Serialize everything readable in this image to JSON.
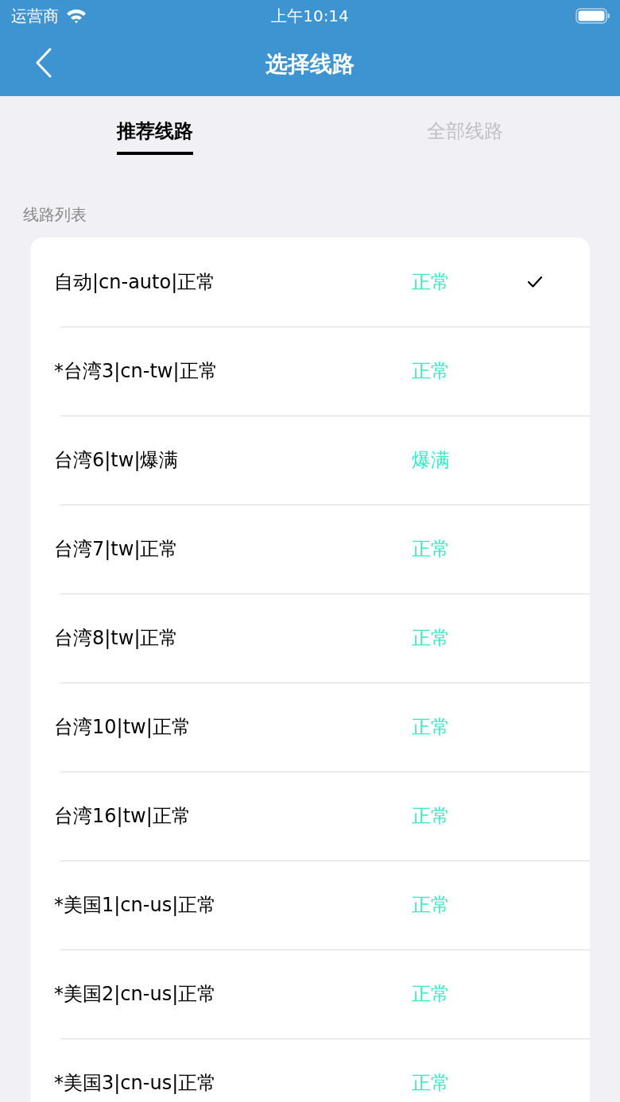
{
  "status_bar": {
    "carrier": "运营商",
    "time": "上午10:14"
  },
  "nav_bar": {
    "title": "选择线路"
  },
  "tabs": [
    {
      "label": "推荐线路",
      "selected": true
    },
    {
      "label": "全部线路",
      "selected": false
    }
  ],
  "section": {
    "title": "线路列表"
  },
  "routes": [
    {
      "name": "自动|cn-auto|正常",
      "status": "正常",
      "selected": true
    },
    {
      "name": "*台湾3|cn-tw|正常",
      "status": "正常",
      "selected": false
    },
    {
      "name": "台湾6|tw|爆满",
      "status": "爆满",
      "selected": false
    },
    {
      "name": "台湾7|tw|正常",
      "status": "正常",
      "selected": false
    },
    {
      "name": "台湾8|tw|正常",
      "status": "正常",
      "selected": false
    },
    {
      "name": "台湾10|tw|正常",
      "status": "正常",
      "selected": false
    },
    {
      "name": "台湾16|tw|正常",
      "status": "正常",
      "selected": false
    },
    {
      "name": "*美国1|cn-us|正常",
      "status": "正常",
      "selected": false
    },
    {
      "name": "*美国2|cn-us|正常",
      "status": "正常",
      "selected": false
    },
    {
      "name": "*美国3|cn-us|正常",
      "status": "正常",
      "selected": false
    }
  ]
}
